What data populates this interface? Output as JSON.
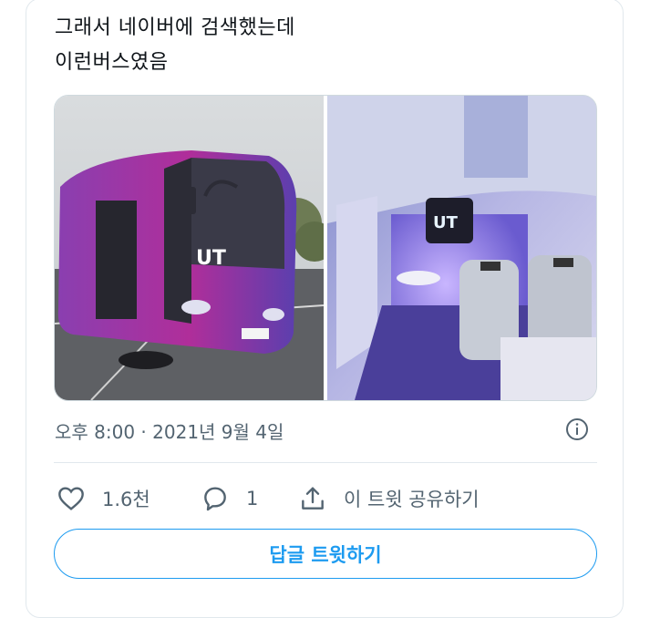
{
  "tweet": {
    "text_line1": "그래서 네이버에 검색했는데",
    "text_line2": "이런버스였음",
    "timestamp": "오후 8:00 · 2021년 9월 4일"
  },
  "media": {
    "left_image_logo": "UT",
    "right_image_logo": "UT"
  },
  "actions": {
    "like_count": "1.6천",
    "reply_count": "1",
    "share_label": "이 트윗 공유하기"
  },
  "reply_button": {
    "label": "답글 트윗하기"
  },
  "colors": {
    "accent": "#1d9bf0",
    "muted": "#536471",
    "border": "#e1e8ed"
  },
  "icons": [
    "heart-icon",
    "reply-bubble-icon",
    "share-icon",
    "info-icon"
  ]
}
